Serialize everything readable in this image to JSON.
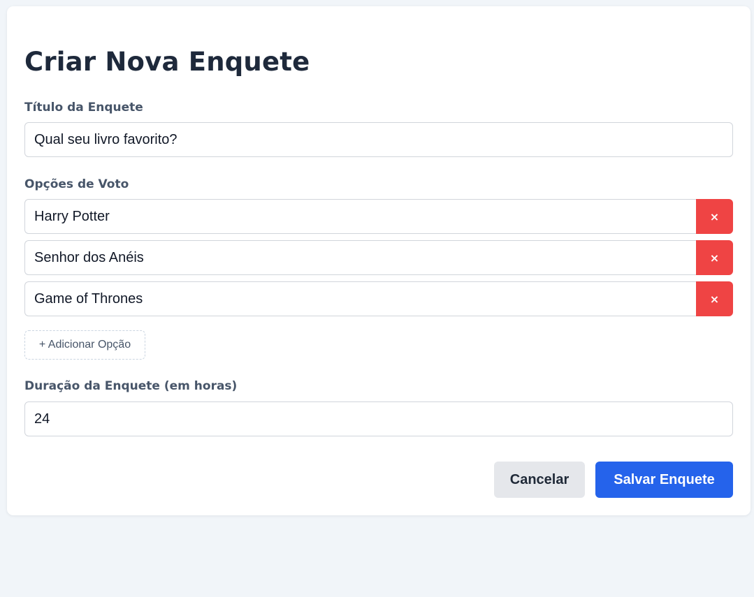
{
  "form": {
    "title": "Criar Nova Enquete",
    "poll_title_label": "Título da Enquete",
    "poll_title_value": "Qual seu livro favorito?",
    "options_label": "Opções de Voto",
    "options": [
      {
        "value": "Harry Potter",
        "remove_label": "×"
      },
      {
        "value": "Senhor dos Anéis",
        "remove_label": "×"
      },
      {
        "value": "Game of Thrones",
        "remove_label": "×"
      }
    ],
    "add_option_label": "+ Adicionar Opção",
    "duration_label": "Duração da Enquete (em horas)",
    "duration_value": "24",
    "cancel_label": "Cancelar",
    "save_label": "Salvar Enquete"
  },
  "colors": {
    "background": "#f1f5f9",
    "card": "#ffffff",
    "title_text": "#1e293b",
    "label_text": "#475569",
    "remove_button": "#ef4444",
    "save_button": "#2563eb",
    "cancel_button": "#e5e7eb"
  },
  "icons": {
    "remove": "close-icon"
  }
}
